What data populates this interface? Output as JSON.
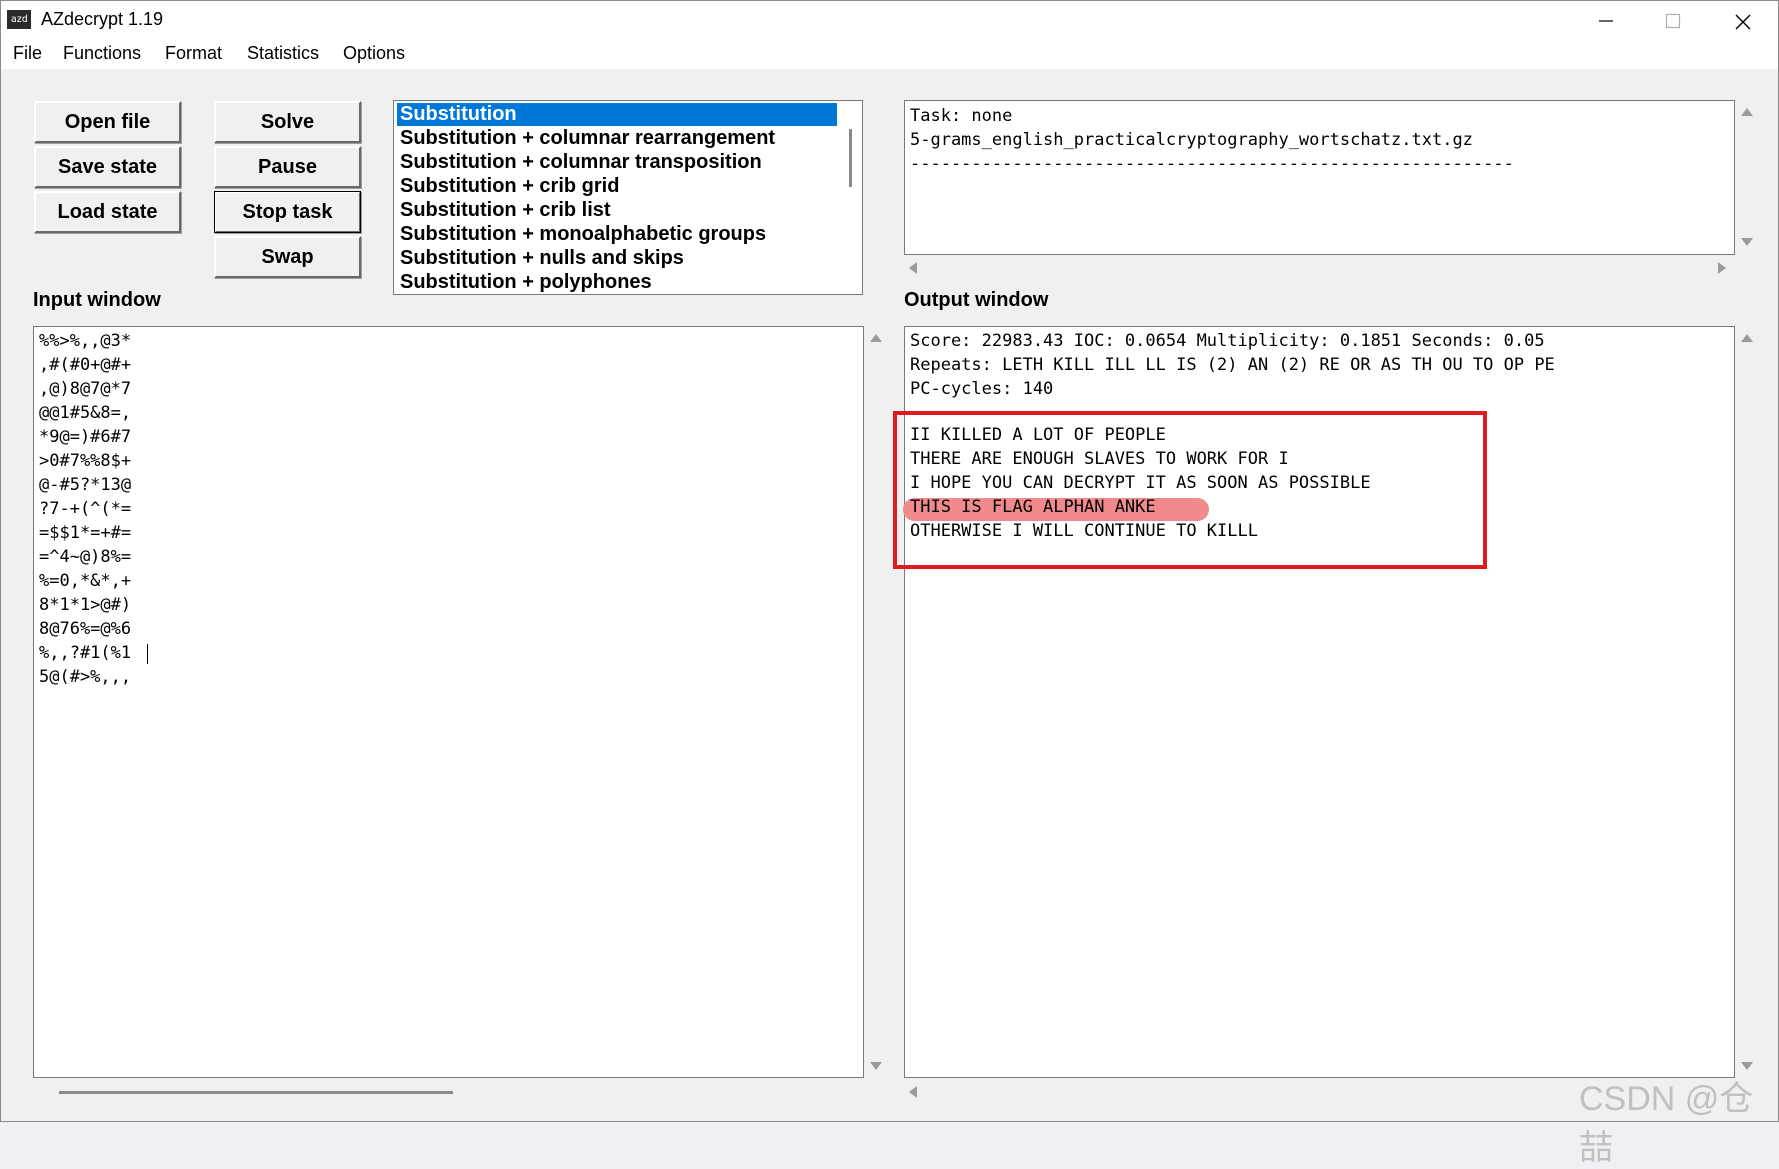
{
  "window": {
    "icon_text": "azd",
    "title": "AZdecrypt 1.19"
  },
  "menu": [
    "File",
    "Functions",
    "Format",
    "Statistics",
    "Options"
  ],
  "buttons": {
    "open_file": "Open file",
    "save_state": "Save state",
    "load_state": "Load state",
    "solve": "Solve",
    "pause": "Pause",
    "stop_task": "Stop task",
    "swap": "Swap"
  },
  "solver_list": {
    "selected_index": 0,
    "items": [
      "Substitution",
      "Substitution + columnar rearrangement",
      "Substitution + columnar transposition",
      "Substitution + crib grid",
      "Substitution + crib list",
      "Substitution + monoalphabetic groups",
      "Substitution + nulls and skips",
      "Substitution + polyphones"
    ]
  },
  "status": {
    "lines": [
      "Task: none",
      "5-grams_english_practicalcryptography_wortschatz.txt.gz",
      "-----------------------------------------------------------"
    ]
  },
  "input_window": {
    "label": "Input window",
    "lines": [
      "%%>%,,@3*",
      ",#(#0+@#+",
      ",@)8@7@*7",
      "@@1#5&8=,",
      "*9@=)#6#7",
      ">0#7%%8$+",
      "@-#5?*13@",
      "?7-+(^(*=",
      "=$$1*=+#=",
      "=^4~@)8%=",
      "%=0,*&*,+",
      "8*1*1>@#)",
      "8@76%=@%6",
      "%,,?#1(%1",
      "5@(#>%,,,"
    ]
  },
  "output_window": {
    "label": "Output window",
    "stats_lines": [
      "Score: 22983.43 IOC: 0.0654 Multiplicity: 0.1851 Seconds: 0.05",
      "Repeats: LETH KILL ILL LL IS (2) AN (2) RE OR AS TH OU TO OP PE",
      "PC-cycles: 140"
    ],
    "plaintext_lines": [
      "II KILLED A LOT OF PEOPLE",
      "THERE ARE ENOUGH SLAVES TO WORK FOR I",
      "I HOPE YOU CAN DECRYPT IT AS SOON AS POSSIBLE",
      "THIS IS FLAG ALPHAN ANKE",
      "OTHERWISE I WILL CONTINUE TO KILLL"
    ]
  },
  "watermark": "CSDN @仓喆",
  "colors": {
    "selection": "#0078d7",
    "annotation_box": "#e01a1f",
    "annotation_highlight": "#f08a8c"
  }
}
